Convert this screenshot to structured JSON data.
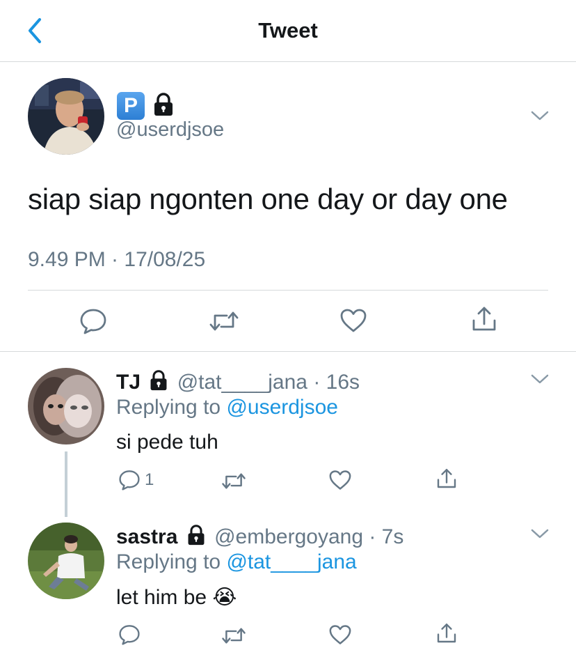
{
  "header": {
    "title": "Tweet",
    "back_icon": "chevron-left-icon",
    "accent": "#1b95e0"
  },
  "main_tweet": {
    "avatar_icon": "user-avatar-photo",
    "badge_letter": "P",
    "lock_icon": "lock-icon",
    "handle": "@userdjsoe",
    "text": "siap siap ngonten one day or day one",
    "timestamp": "9.49 PM · 17/08/25",
    "actions": [
      "reply-icon",
      "retweet-icon",
      "like-icon",
      "share-icon"
    ]
  },
  "replies": [
    {
      "name": "TJ",
      "handle": "@tat____jana",
      "time": "· 16s",
      "replying_prefix": "Replying to ",
      "replying_to": "@userdjsoe",
      "text": "si pede tuh",
      "reply_count": "1"
    },
    {
      "name": "sastra",
      "handle": "@embergoyang",
      "time": "· 7s",
      "replying_prefix": "Replying to ",
      "replying_to": "@tat____jana",
      "text": "let him be",
      "emoji": "😭",
      "reply_count": ""
    }
  ],
  "colors": {
    "text": "#14171a",
    "muted": "#657786",
    "link": "#1b95e0",
    "divider": "#d6d9db"
  }
}
